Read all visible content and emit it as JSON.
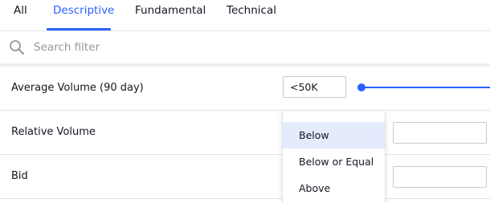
{
  "tabs": [
    {
      "label": "All"
    },
    {
      "label": "Descriptive"
    },
    {
      "label": "Fundamental"
    },
    {
      "label": "Technical"
    }
  ],
  "active_tab": "Descriptive",
  "search": {
    "placeholder": "Search filter",
    "value": ""
  },
  "filters": [
    {
      "label": "Average Volume (90 day)",
      "value": "<50K"
    },
    {
      "label": "Relative Volume",
      "value": ""
    },
    {
      "label": "Bid",
      "value": ""
    }
  ],
  "dropdown": {
    "options": [
      {
        "label": "Below"
      },
      {
        "label": "Below or Equal"
      },
      {
        "label": "Above"
      }
    ],
    "highlighted": "Below"
  },
  "colors": {
    "accent": "#2962ff",
    "highlight": "#e3ebfd",
    "border": "#e0e3eb",
    "placeholder": "#9598a1"
  },
  "icons": {
    "search": "search-icon"
  }
}
